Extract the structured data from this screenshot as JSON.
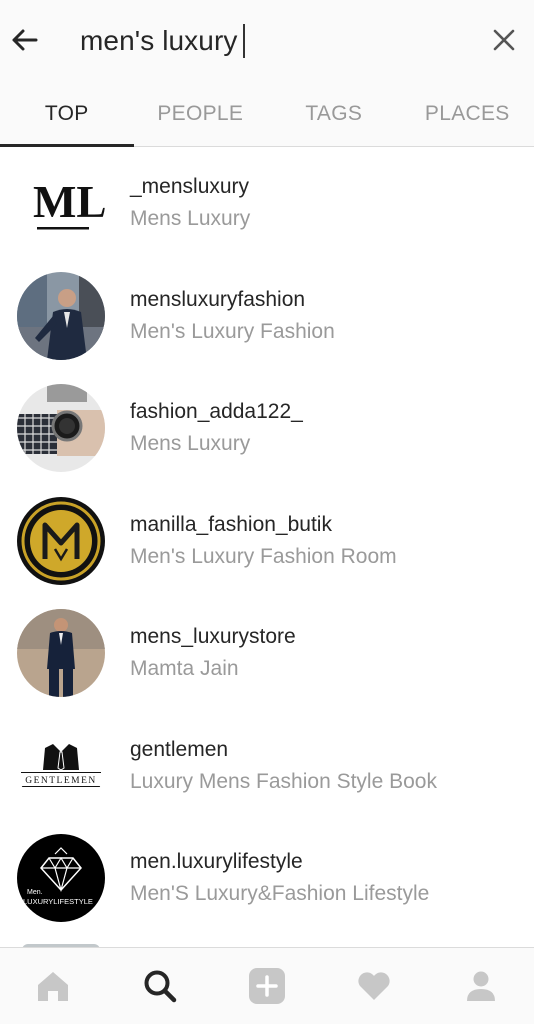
{
  "search": {
    "query": "men's luxury",
    "back_icon": "arrow-left-icon",
    "clear_icon": "close-icon"
  },
  "tabs": [
    {
      "label": "TOP",
      "active": true
    },
    {
      "label": "PEOPLE",
      "active": false
    },
    {
      "label": "TAGS",
      "active": false
    },
    {
      "label": "PLACES",
      "active": false
    }
  ],
  "results": [
    {
      "username": "_mensluxury",
      "fullname": "Mens Luxury",
      "avatar": "ml-logo"
    },
    {
      "username": "mensluxuryfashion",
      "fullname": "Men's Luxury Fashion",
      "avatar": "man-in-suit-photo"
    },
    {
      "username": "fashion_adda122_",
      "fullname": "Mens Luxury",
      "avatar": "watch-photo"
    },
    {
      "username": "manilla_fashion_butik",
      "fullname": "Men's Luxury Fashion Room",
      "avatar": "gold-m-emblem"
    },
    {
      "username": "mens_luxurystore",
      "fullname": "Mamta Jain",
      "avatar": "man-in-suit-street-photo"
    },
    {
      "username": "gentlemen",
      "fullname": "Luxury Mens Fashion Style Book",
      "avatar": "gentlemen-logo"
    },
    {
      "username": "men.luxurylifestyle",
      "fullname": "Men'S Luxury&Fashion Lifestyle",
      "avatar": "diamond-logo"
    }
  ],
  "logos": {
    "ml_text": "ML",
    "gentlemen_text": "GENTLEMEN",
    "diamond_line1": "Men.",
    "diamond_line2": "LUXURYLIFESTYLE"
  },
  "bottom_nav": [
    {
      "icon": "home-icon",
      "active": false
    },
    {
      "icon": "search-icon",
      "active": true
    },
    {
      "icon": "add-icon",
      "active": false
    },
    {
      "icon": "heart-icon",
      "active": false
    },
    {
      "icon": "profile-icon",
      "active": false
    }
  ],
  "colors": {
    "text_primary": "#262626",
    "text_secondary": "#9a9a9a",
    "inactive_icon": "#c7c7c7",
    "header_bg": "#fafafa"
  }
}
